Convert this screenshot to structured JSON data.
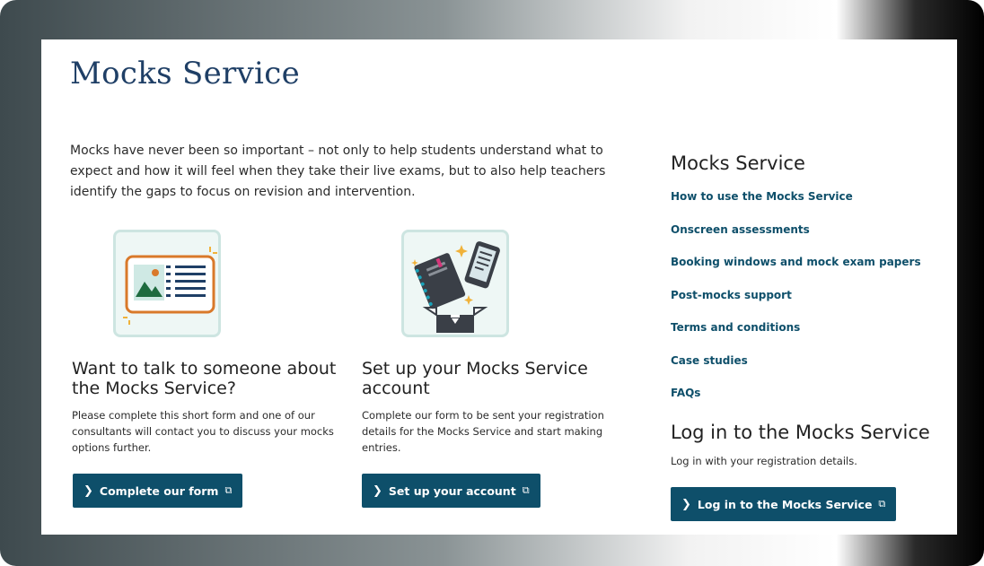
{
  "page": {
    "title": "Mocks Service",
    "intro": "Mocks have never been so important – not only to help students understand what to expect and how it will feel when they take their live exams, but to also help teachers identify the gaps to focus on revision and intervention."
  },
  "cards": [
    {
      "title": "Want to talk to someone about the Mocks Service?",
      "body": "Please complete this short form and one of our consultants will contact you to discuss your mocks options further.",
      "button": "Complete our form"
    },
    {
      "title": "Set up your Mocks Service account",
      "body": "Complete our form to be sent your registration details for the Mocks Service and start making entries.",
      "button": "Set up your account"
    }
  ],
  "sidebar": {
    "title": "Mocks Service",
    "links": [
      "How to use the Mocks Service",
      "Onscreen assessments",
      "Booking windows and mock exam papers",
      "Post-mocks support",
      "Terms and conditions",
      "Case studies",
      "FAQs"
    ],
    "login_title": "Log in to the Mocks Service",
    "login_text": "Log in with your registration details.",
    "login_button": "Log in to the Mocks Service"
  },
  "icons": {
    "chevron": "chevron-right-icon",
    "external": "external-link-icon",
    "card1_illustration": "profile-card-illustration",
    "card2_illustration": "notebook-tablet-box-illustration"
  },
  "colors": {
    "brand_blue": "#0e4f6a",
    "title_navy": "#1f3f66",
    "illustration_bg": "#eef7f5",
    "accent_orange": "#d9792a"
  }
}
